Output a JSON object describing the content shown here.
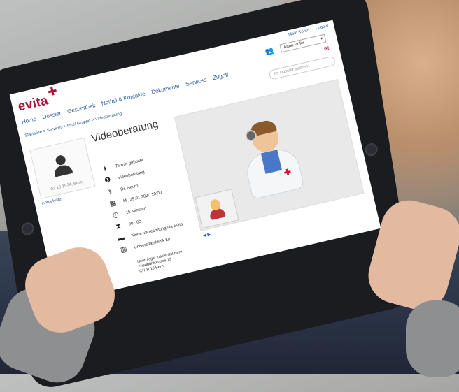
{
  "app": {
    "brand": "evita",
    "brand_mark": "✚"
  },
  "top_links": {
    "account": "Mein Konto",
    "logout": "Logout"
  },
  "user_select": {
    "value": "Anna Hofer"
  },
  "search": {
    "placeholder": "Im Dossier suchen..."
  },
  "nav": {
    "items": [
      "Home",
      "Dossier",
      "Gesundheit",
      "Notfall & Kontakte",
      "Dokumente",
      "Services",
      "Zugriff"
    ]
  },
  "breadcrumb": "Startseite > Services > Insel Gruppe > Videoberatung",
  "profile": {
    "birthdate": "03.10.1974, Bern",
    "name": "Anna Hofer"
  },
  "page": {
    "title": "Videoberatung"
  },
  "details": [
    {
      "icon": "info-icon",
      "glyph": "ℹ",
      "text": "Termin gebucht"
    },
    {
      "icon": "info-circle-icon",
      "glyph": "❶",
      "text": "Videoberatung"
    },
    {
      "icon": "doctor-icon",
      "glyph": "⚕",
      "text": "Dr. Neuro"
    },
    {
      "icon": "calendar-icon",
      "glyph": "▦",
      "text": "Mi, 29.01.2020 10:00"
    },
    {
      "icon": "clock-icon",
      "glyph": "◷",
      "text": "15 Minuten"
    },
    {
      "icon": "hourglass-icon",
      "glyph": "⧗",
      "text": "00 : 00"
    },
    {
      "icon": "card-icon",
      "glyph": "▬",
      "text": "Keine Verrechnung via Evita"
    },
    {
      "icon": "building-icon",
      "glyph": "▥",
      "text": "Universitätsklinik für"
    }
  ],
  "address": [
    "Neurologie Inselspital Bern",
    "Friedbühlstrasse 19",
    "CH-3010 Bern"
  ],
  "video_controls": "◀ ▶",
  "colors": {
    "brand": "#b0103a",
    "link": "#2b5c9c"
  }
}
